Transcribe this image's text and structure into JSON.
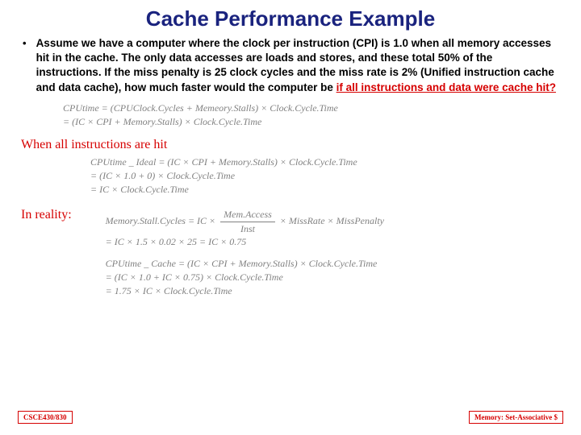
{
  "title": "Cache Performance Example",
  "bullet": {
    "pre": "Assume we have a computer where the clock per instruction (CPI) is 1.0 when all memory accesses hit in the cache. The only data accesses are loads and stores, and these total 50% of the instructions. If the miss penalty is 25 clock cycles and the miss rate is 2% (Unified instruction cache and data cache), how much faster would the computer be ",
    "highlight": "if all instructions and data were cache hit?"
  },
  "eq1": {
    "l1": "CPUtime = (CPUClock.Cycles + Memeory.Stalls) × Clock.Cycle.Time",
    "l2": "= (IC × CPI + Memory.Stalls) × Clock.Cycle.Time"
  },
  "subhead1": "When all instructions are hit",
  "eq2": {
    "l1": "CPUtime _ Ideal = (IC × CPI + Memory.Stalls) × Clock.Cycle.Time",
    "l2": "= (IC × 1.0 + 0) × Clock.Cycle.Time",
    "l3": "= IC × Clock.Cycle.Time"
  },
  "subhead2": "In reality:",
  "eq3": {
    "l1_pre": "Memory.Stall.Cycles = IC × ",
    "l1_num": "Mem.Access",
    "l1_den": "Inst",
    "l1_post": " × MissRate × MissPenalty",
    "l2": "= IC × 1.5 × 0.02 × 25 = IC × 0.75",
    "l3": "CPUtime _ Cache = (IC × CPI + Memory.Stalls) × Clock.Cycle.Time",
    "l4": "= (IC × 1.0 + IC × 0.75) × Clock.Cycle.Time",
    "l5": "= 1.75 × IC × Clock.Cycle.Time"
  },
  "footer_left": "CSCE430/830",
  "footer_right": "Memory: Set-Associative $"
}
